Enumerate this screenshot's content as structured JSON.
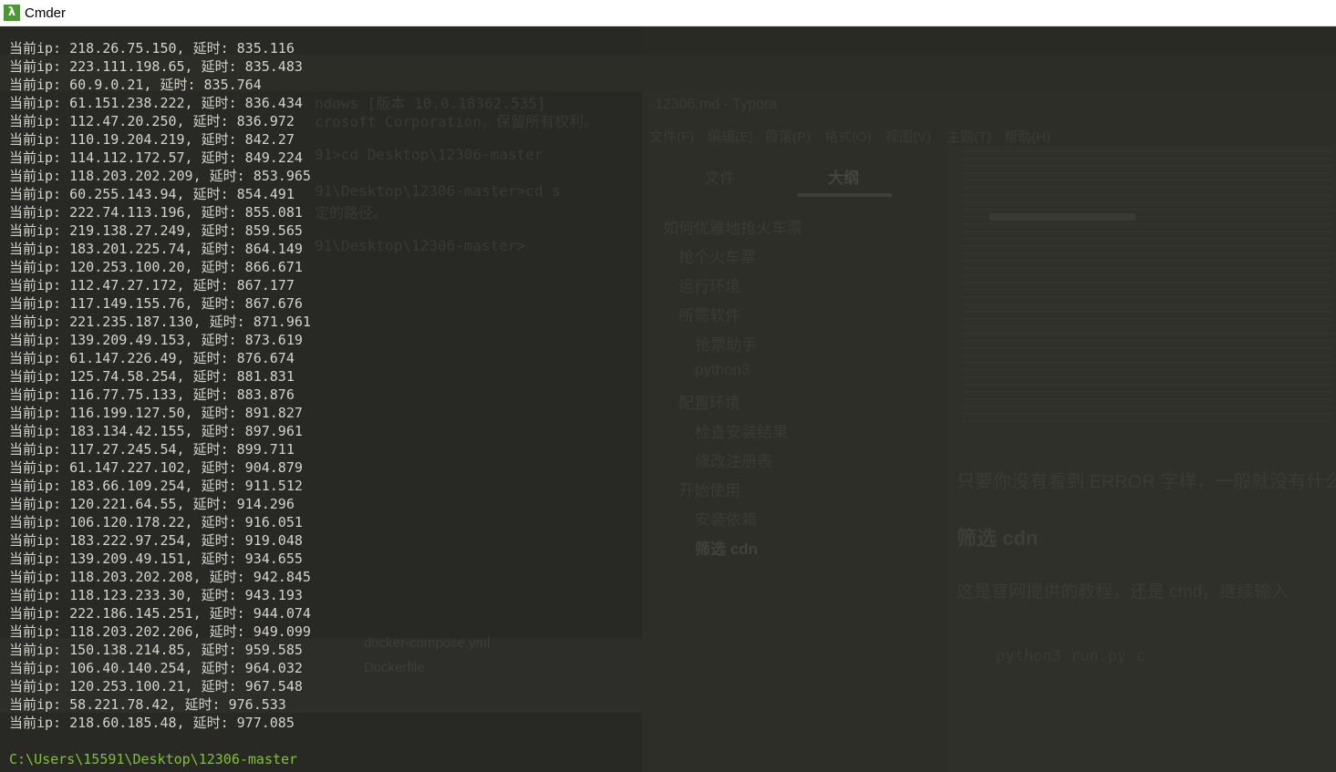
{
  "window": {
    "title": "Cmder",
    "icon": "lambda-icon",
    "accent_color": "#4a9b2f"
  },
  "console": {
    "lines": [
      "当前ip: 218.26.75.150, 延时: 835.116",
      "当前ip: 223.111.198.65, 延时: 835.483",
      "当前ip: 60.9.0.21, 延时: 835.764",
      "当前ip: 61.151.238.222, 延时: 836.434",
      "当前ip: 112.47.20.250, 延时: 836.972",
      "当前ip: 110.19.204.219, 延时: 842.27",
      "当前ip: 114.112.172.57, 延时: 849.224",
      "当前ip: 118.203.202.209, 延时: 853.965",
      "当前ip: 60.255.143.94, 延时: 854.491",
      "当前ip: 222.74.113.196, 延时: 855.081",
      "当前ip: 219.138.27.249, 延时: 859.565",
      "当前ip: 183.201.225.74, 延时: 864.149",
      "当前ip: 120.253.100.20, 延时: 866.671",
      "当前ip: 112.47.27.172, 延时: 867.177",
      "当前ip: 117.149.155.76, 延时: 867.676",
      "当前ip: 221.235.187.130, 延时: 871.961",
      "当前ip: 139.209.49.153, 延时: 873.619",
      "当前ip: 61.147.226.49, 延时: 876.674",
      "当前ip: 125.74.58.254, 延时: 881.831",
      "当前ip: 116.77.75.133, 延时: 883.876",
      "当前ip: 116.199.127.50, 延时: 891.827",
      "当前ip: 183.134.42.155, 延时: 897.961",
      "当前ip: 117.27.245.54, 延时: 899.711",
      "当前ip: 61.147.227.102, 延时: 904.879",
      "当前ip: 183.66.109.254, 延时: 911.512",
      "当前ip: 120.221.64.55, 延时: 914.296",
      "当前ip: 106.120.178.22, 延时: 916.051",
      "当前ip: 183.222.97.254, 延时: 919.048",
      "当前ip: 139.209.49.151, 延时: 934.655",
      "当前ip: 118.203.202.208, 延时: 942.845",
      "当前ip: 118.123.233.30, 延时: 943.193",
      "当前ip: 222.186.145.251, 延时: 944.074",
      "当前ip: 118.203.202.206, 延时: 949.099",
      "当前ip: 150.138.214.85, 延时: 959.585",
      "当前ip: 106.40.140.254, 延时: 964.032",
      "当前ip: 120.253.100.21, 延时: 967.548",
      "当前ip: 58.221.78.42, 延时: 976.533",
      "当前ip: 218.60.185.48, 延时: 977.085"
    ],
    "prompt": "C:\\Users\\15591\\Desktop\\12306-master",
    "prompt_color": "#7dc42b",
    "text_color": "#d4d4cc"
  },
  "background_ghost": {
    "cmd_lines": [
      "ndows [版本 10.0.18362.535]",
      "crosoft Corporation。保留所有权利。",
      "91>cd Desktop\\12306-master",
      "91\\Desktop\\12306-master>cd s",
      "定的路径。",
      "91\\Desktop\\12306-master>"
    ],
    "typora_title": "12306.md - Typora",
    "typora_menu": [
      "文件(F)",
      "编辑(E)",
      "段落(P)",
      "格式(O)",
      "视图(V)",
      "主题(T)",
      "帮助(H)"
    ],
    "typora_tabs": [
      "文件",
      "大纲"
    ],
    "outline": [
      "如何优雅地抢火车票",
      "抢个火车票",
      "运行环境",
      "所需软件",
      "抢票助手",
      "python3",
      "配置环境",
      "检查安装结果",
      "修改注册表",
      "开始使用",
      "安装依赖",
      "筛选 cdn"
    ],
    "doc_text_1": "只要你没有看到 ERROR 字样，一般就没有什么",
    "doc_heading": "筛选 cdn",
    "doc_text_2": "这是官网提供的教程，还是 cmd，继续输入",
    "doc_code": "python3 run.py c",
    "explorer_files": [
      "docker-compose.yml",
      "Dockerfile"
    ]
  }
}
